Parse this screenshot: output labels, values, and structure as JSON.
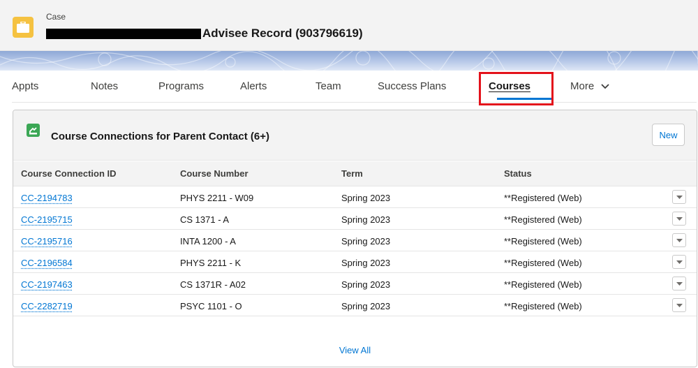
{
  "header": {
    "object_label": "Case",
    "title": "Advisee Record (903796619)"
  },
  "tabs": [
    {
      "label": "Appts"
    },
    {
      "label": "Notes"
    },
    {
      "label": "Programs"
    },
    {
      "label": "Alerts"
    },
    {
      "label": "Team"
    },
    {
      "label": "Success Plans"
    },
    {
      "label": "Courses"
    },
    {
      "label": "More"
    }
  ],
  "active_tab": "Courses",
  "card": {
    "title": "Course Connections for Parent Contact (6+)",
    "new_label": "New",
    "columns": [
      "Course Connection ID",
      "Course Number",
      "Term",
      "Status"
    ],
    "rows": [
      {
        "id": "CC-2194783",
        "course": "PHYS 2211 - W09",
        "term": "Spring 2023",
        "status": "**Registered (Web)"
      },
      {
        "id": "CC-2195715",
        "course": "CS 1371 - A",
        "term": "Spring 2023",
        "status": "**Registered (Web)"
      },
      {
        "id": "CC-2195716",
        "course": "INTA 1200 - A",
        "term": "Spring 2023",
        "status": "**Registered (Web)"
      },
      {
        "id": "CC-2196584",
        "course": "PHYS 2211 - K",
        "term": "Spring 2023",
        "status": "**Registered (Web)"
      },
      {
        "id": "CC-2197463",
        "course": "CS 1371R - A02",
        "term": "Spring 2023",
        "status": "**Registered (Web)"
      },
      {
        "id": "CC-2282719",
        "course": "PSYC 1101 - O",
        "term": "Spring 2023",
        "status": "**Registered (Web)"
      }
    ],
    "view_all_label": "View All"
  },
  "colors": {
    "brand_blue": "#0176d3",
    "case_icon": "#f5c241",
    "card_icon": "#3ba755",
    "highlight": "#e3121b"
  },
  "icons": {
    "case": "briefcase-icon",
    "card": "course-connection-icon",
    "more": "chevron-down-icon",
    "row_action": "dropdown-arrow-icon"
  }
}
